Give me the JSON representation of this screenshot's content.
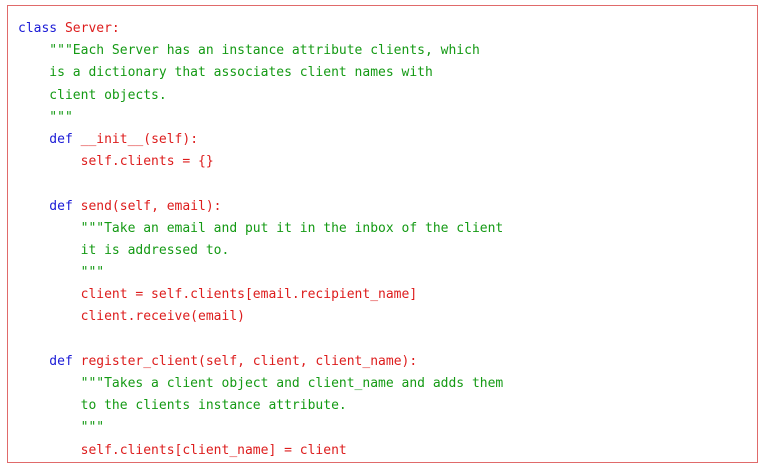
{
  "code": {
    "lines": [
      [
        {
          "t": "class",
          "k": "keyword"
        },
        {
          "t": " Server:",
          "k": "code"
        }
      ],
      [
        {
          "t": "    \"\"\"Each Server has an instance attribute clients, which",
          "k": "doc"
        }
      ],
      [
        {
          "t": "    is a dictionary that associates client names with",
          "k": "doc"
        }
      ],
      [
        {
          "t": "    client objects.",
          "k": "doc"
        }
      ],
      [
        {
          "t": "    \"\"\"",
          "k": "doc"
        }
      ],
      [
        {
          "t": "    def",
          "k": "keyword"
        },
        {
          "t": " __init__(self):",
          "k": "code"
        }
      ],
      [
        {
          "t": "        self.clients = {}",
          "k": "code"
        }
      ],
      [],
      [
        {
          "t": "    def",
          "k": "keyword"
        },
        {
          "t": " send(self, email):",
          "k": "code"
        }
      ],
      [
        {
          "t": "        \"\"\"Take an email and put it in the inbox of the client",
          "k": "doc"
        }
      ],
      [
        {
          "t": "        it is addressed to.",
          "k": "doc"
        }
      ],
      [
        {
          "t": "        \"\"\"",
          "k": "doc"
        }
      ],
      [
        {
          "t": "        client = self.clients[email.recipient_name]",
          "k": "code"
        }
      ],
      [
        {
          "t": "        client.receive(email)",
          "k": "code"
        }
      ],
      [],
      [
        {
          "t": "    def",
          "k": "keyword"
        },
        {
          "t": " register_client(self, client, client_name):",
          "k": "code"
        }
      ],
      [
        {
          "t": "        \"\"\"Takes a client object and client_name and adds them",
          "k": "doc"
        }
      ],
      [
        {
          "t": "        to the clients instance attribute.",
          "k": "doc"
        }
      ],
      [
        {
          "t": "        \"\"\"",
          "k": "doc"
        }
      ],
      [
        {
          "t": "        self.clients[client_name] = client",
          "k": "code"
        }
      ]
    ]
  },
  "colors": {
    "keyword": "#1a1ad6",
    "code": "#dd1c1c",
    "docstring": "#149a14",
    "frame_border": "#e06a6a"
  }
}
